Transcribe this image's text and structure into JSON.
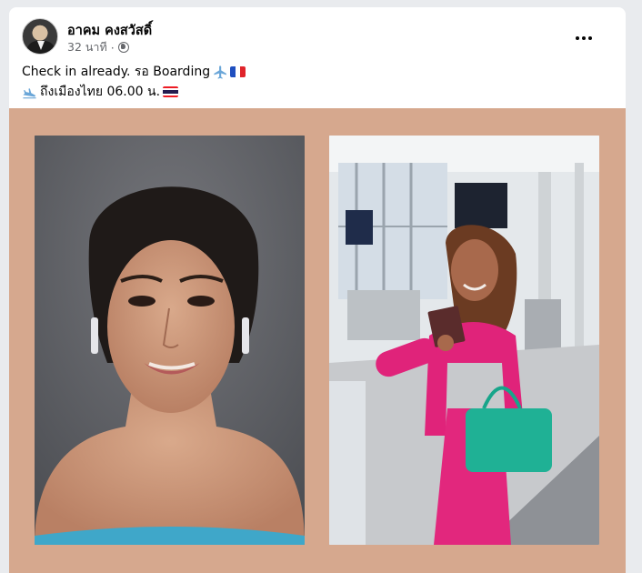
{
  "post": {
    "author": "อาคม คงสวัสดิ์",
    "time": "32 นาที",
    "separator": "·",
    "line1_text": "Check in already. รอ Boarding",
    "line2_text": "ถึงเมืองไทย 06.00 น.",
    "icons": [
      "airplane-icon",
      "france-flag-icon",
      "airplane-landing-icon",
      "thailand-flag-icon",
      "globe-icon",
      "more-options-icon"
    ]
  },
  "photos": [
    {
      "name": "portrait-photo",
      "description_colors": [
        "#5b5d62",
        "#8a8080"
      ]
    },
    {
      "name": "airport-photo",
      "description_colors": [
        "#e8ecef",
        "#bfc3c7"
      ]
    }
  ],
  "colors": {
    "media_background": "#d6a88e",
    "text_primary": "#050505",
    "text_secondary": "#65676b"
  }
}
